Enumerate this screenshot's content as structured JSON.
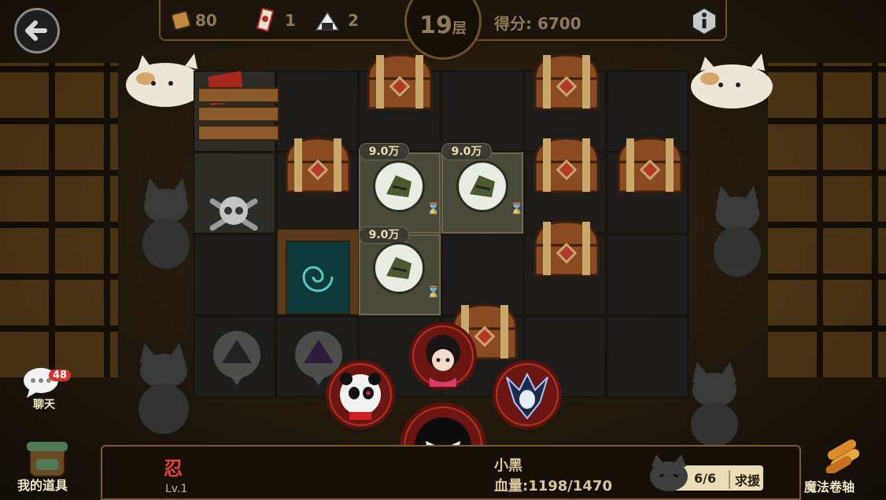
{
  "hud": {
    "scrolls": "80",
    "tickets": "1",
    "riceballs": "2",
    "floor_number": "19",
    "floor_unit": "层",
    "score_label": "得分",
    "score_sep": ":",
    "score_value": "6700"
  },
  "grid": {
    "prices": [
      "9.0万",
      "9.0万",
      "9.0万"
    ]
  },
  "chat": {
    "badge_count": "48",
    "label": "聊天"
  },
  "sidebar": {
    "items_label": "我的道具",
    "scroll_label": "魔法卷轴"
  },
  "hero": {
    "class_glyph": "忍",
    "level": "Lv.1",
    "name": "小黑",
    "hp_label": "血量",
    "hp_sep": ":",
    "hp_value": "1198/1470"
  },
  "support": {
    "count": "6/6",
    "button_label": "求援"
  },
  "colors": {
    "accent_gold": "#7d5d2d",
    "health_red": "#b6371b",
    "panel_dark": "#150f08"
  },
  "icons": [
    "back-arrow-icon",
    "scroll-icon",
    "ticket-icon",
    "riceball-icon",
    "info-icon",
    "chest-icon",
    "skull-icon",
    "vortex-portal-icon",
    "hourglass-icon",
    "cat-icon",
    "backpack-icon",
    "magic-scroll-icon",
    "chat-bubble-icon"
  ]
}
